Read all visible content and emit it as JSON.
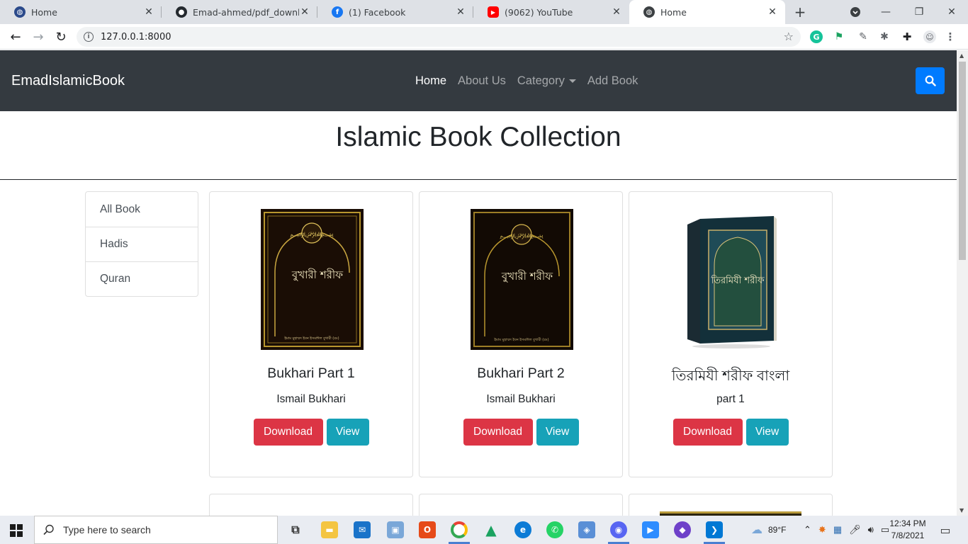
{
  "browser": {
    "tabs": [
      {
        "title": "Home",
        "icon": "globe-icon"
      },
      {
        "title": "Emad-ahmed/pdf_downloader",
        "icon": "github-icon"
      },
      {
        "title": "(1) Facebook",
        "icon": "facebook-icon"
      },
      {
        "title": "(9062) YouTube",
        "icon": "youtube-icon"
      },
      {
        "title": "Home",
        "icon": "globe-icon",
        "active": true
      }
    ],
    "url": "127.0.0.1:8000"
  },
  "site": {
    "brand": "EmadIslamicBook",
    "nav": [
      "Home",
      "About Us",
      "Category",
      "Add Book"
    ],
    "active_nav": "Home",
    "accent": "#007bff"
  },
  "main": {
    "title": "Islamic Book Collection",
    "categories": [
      "All Book",
      "Hadis",
      "Quran"
    ],
    "books": [
      {
        "name": "Bukhari Part 1",
        "author": "Ismail Bukhari",
        "cover_text": "বুখারী শরীফ",
        "cover_sub": "ইমাম মুহাম্মদ ইবন ইসমাঈল বুখারী (রঃ)",
        "download": "Download",
        "view": "View"
      },
      {
        "name": "Bukhari Part 2",
        "author": "Ismail Bukhari",
        "cover_text": "বুখারী শরীফ",
        "cover_sub": "ইমাম মুহাম্মদ ইবন ইসমাঈল বুখারী (রঃ)",
        "download": "Download",
        "view": "View"
      },
      {
        "name": "তিরমিযী শরীফ বাংলা",
        "author": "part 1",
        "cover_text": "তিরমিযী শরীফ",
        "cover_sub": "",
        "download": "Download",
        "view": "View"
      }
    ],
    "button_colors": {
      "download": "#dc3545",
      "view": "#17a2b8"
    }
  },
  "taskbar": {
    "search_placeholder": "Type here to search",
    "weather": "89°F",
    "time": "12:34 PM",
    "date": "7/8/2021"
  }
}
